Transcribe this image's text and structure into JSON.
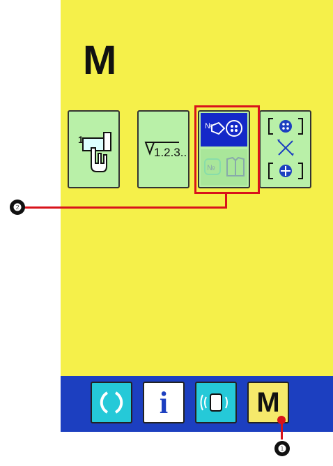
{
  "screen": {
    "title": "M",
    "background_color": "#f5f04a"
  },
  "function_buttons": [
    {
      "name": "counter-setting-button",
      "icon": "sewing-machine-hand-icon",
      "number": "1"
    },
    {
      "name": "sequence-setting-button",
      "icon": "triangle-123-icon",
      "text": "1.2.3.."
    },
    {
      "name": "cycle-program-button",
      "icon": "number-button-icon",
      "lower_icon": "cycle-cloth-icon",
      "selected": true
    },
    {
      "name": "button-exchange-button",
      "icon": "button-exchange-icon"
    }
  ],
  "bottom_bar": {
    "background_color": "#1c3fc0",
    "buttons": [
      {
        "name": "ready-button",
        "icon": "arc-icon"
      },
      {
        "name": "information-button",
        "label": "i"
      },
      {
        "name": "communication-button",
        "icon": "communication-icon"
      },
      {
        "name": "mode-button",
        "label": "M"
      }
    ]
  },
  "callouts": [
    {
      "id": "callout-1",
      "label": "❶"
    },
    {
      "id": "callout-2",
      "label": "❷"
    }
  ],
  "highlight_color": "#d8131b"
}
